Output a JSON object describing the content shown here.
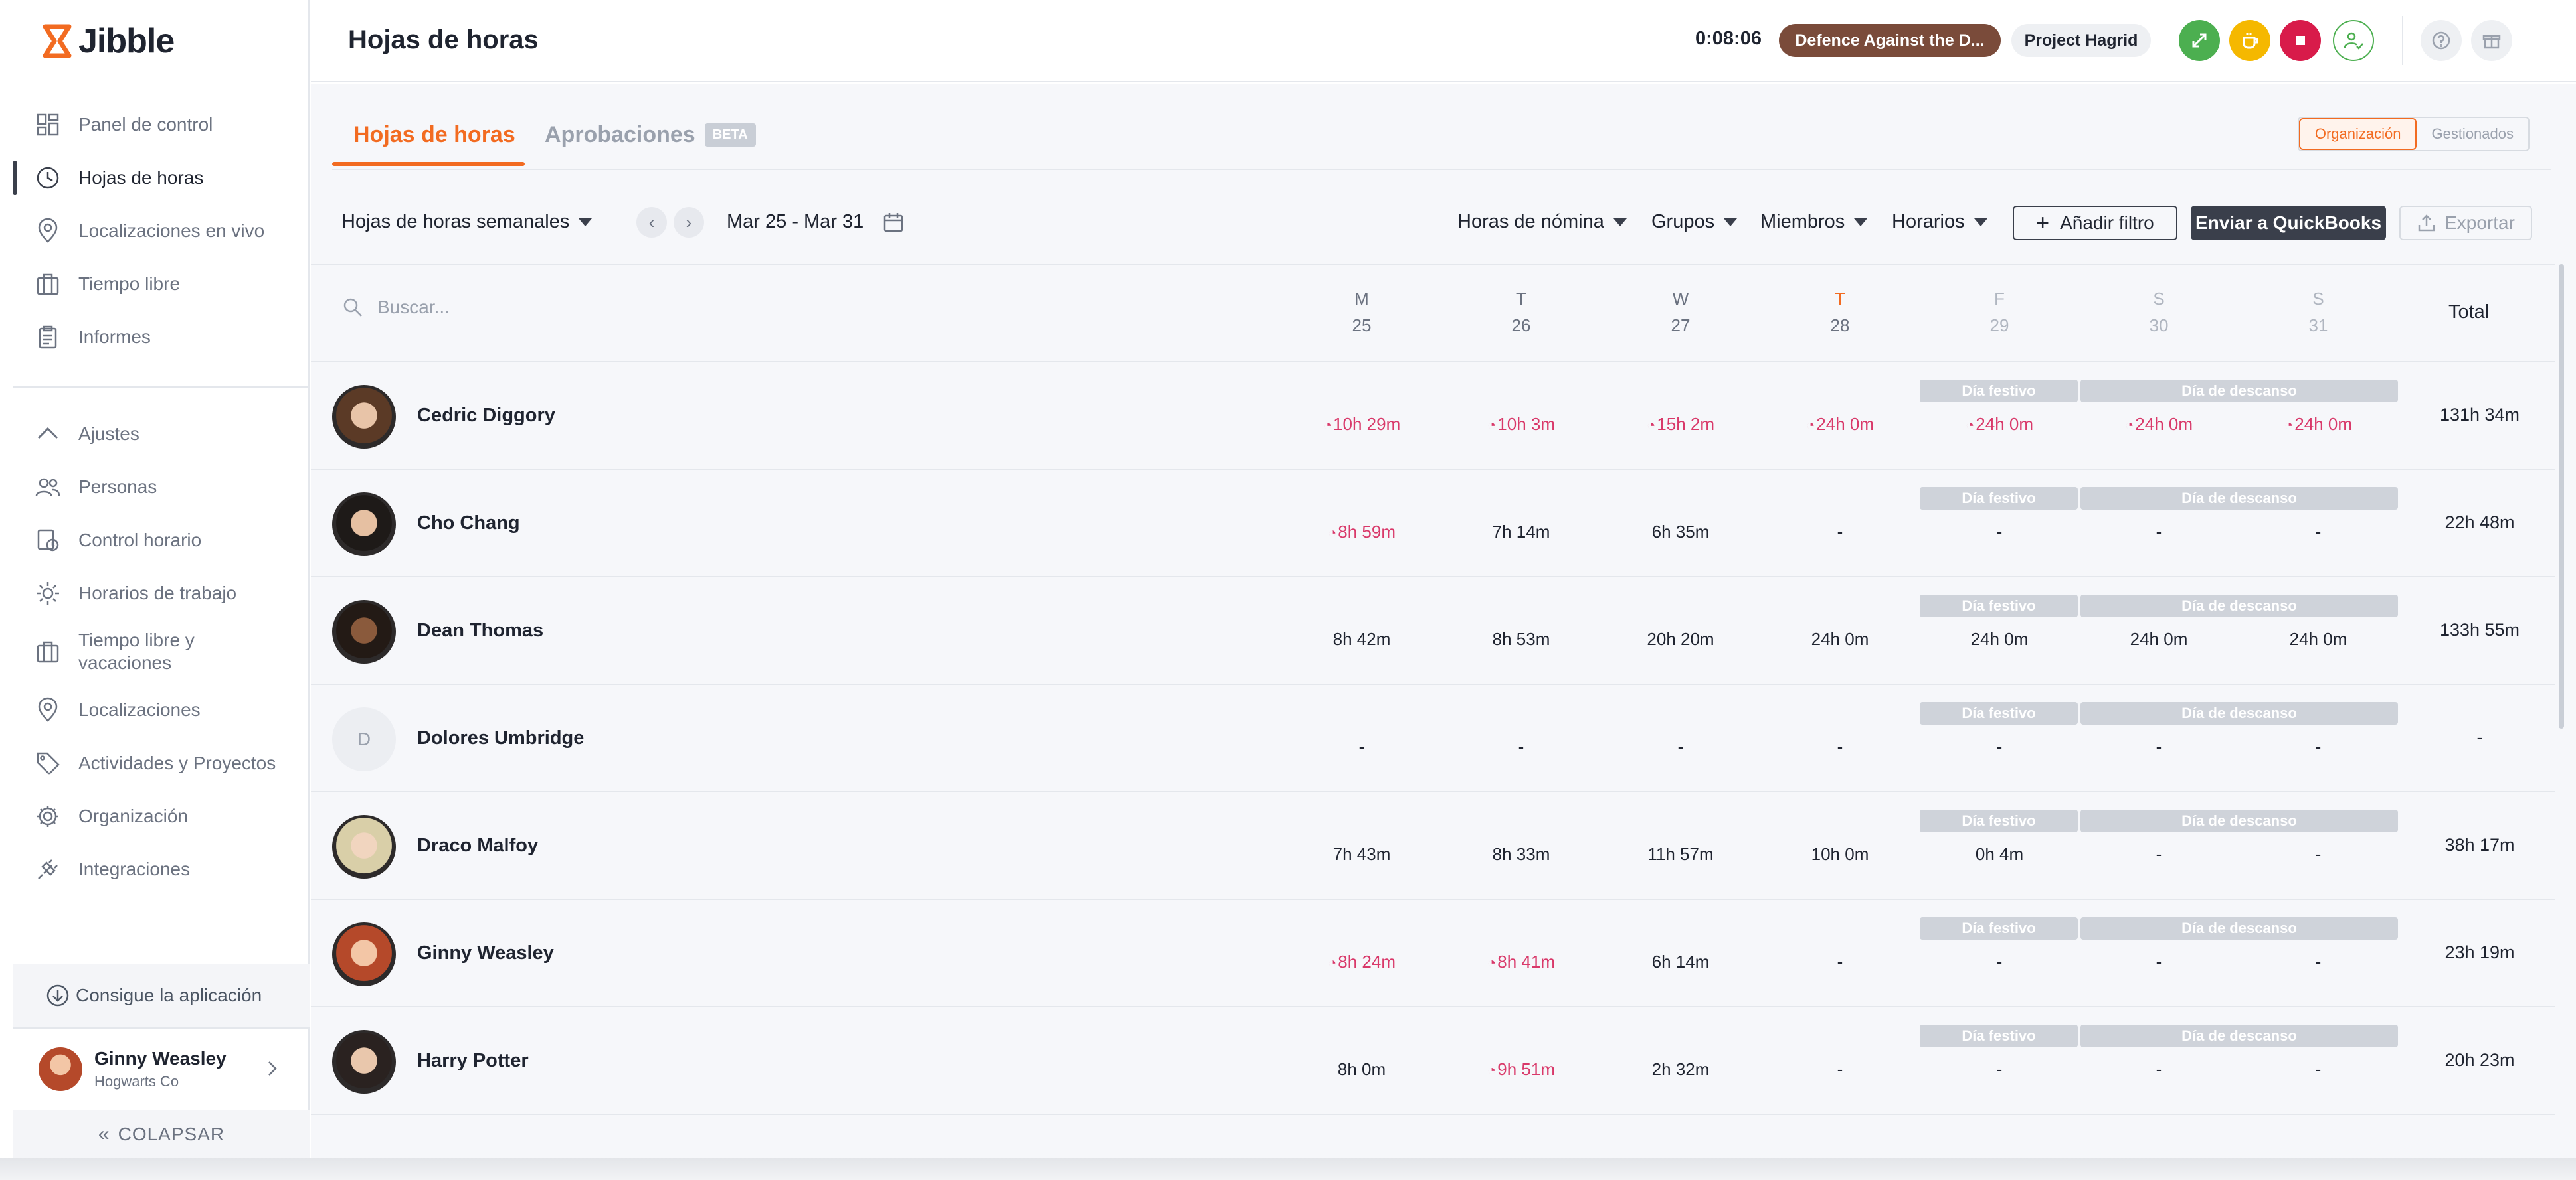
{
  "app": {
    "logo_text": "Jibble"
  },
  "sidebar": {
    "items": [
      {
        "label": "Panel de control",
        "icon": "dashboard-icon"
      },
      {
        "label": "Hojas de horas",
        "icon": "clock-icon"
      },
      {
        "label": "Localizaciones en vivo",
        "icon": "location-icon"
      },
      {
        "label": "Tiempo libre",
        "icon": "briefcase-icon"
      },
      {
        "label": "Informes",
        "icon": "clipboard-icon"
      }
    ],
    "settings_items": [
      {
        "label": "Ajustes",
        "icon": "chevron-up-icon"
      },
      {
        "label": "Personas",
        "icon": "people-icon"
      },
      {
        "label": "Control horario",
        "icon": "time-tracking-icon"
      },
      {
        "label": "Horarios de trabajo",
        "icon": "sun-icon"
      },
      {
        "label": "Tiempo libre y vacaciones",
        "icon": "briefcase-icon"
      },
      {
        "label": "Localizaciones",
        "icon": "location-icon"
      },
      {
        "label": "Actividades y Proyectos",
        "icon": "tag-icon"
      },
      {
        "label": "Organización",
        "icon": "gear-icon"
      },
      {
        "label": "Integraciones",
        "icon": "plug-icon"
      }
    ],
    "get_app": "Consigue la aplicación",
    "user": {
      "name": "Ginny Weasley",
      "org": "Hogwarts Co"
    },
    "collapse": "COLAPSAR"
  },
  "topbar": {
    "title": "Hojas de horas",
    "timer": "0:08:06",
    "activity": "Defence Against the D...",
    "project": "Project Hagrid"
  },
  "tabs": {
    "timesheets": "Hojas de horas",
    "approvals": "Aprobaciones",
    "beta": "BETA",
    "toggle_org": "Organización",
    "toggle_managed": "Gestionados"
  },
  "filters": {
    "period": "Hojas de horas semanales",
    "range": "Mar 25 - Mar 31",
    "payroll": "Horas de nómina",
    "groups": "Grupos",
    "members": "Miembros",
    "schedules": "Horarios",
    "add_filter": "Añadir filtro",
    "quickbooks": "Enviar a QuickBooks",
    "export": "Exportar"
  },
  "table": {
    "search_placeholder": "Buscar...",
    "total_label": "Total",
    "holiday_label": "Día festivo",
    "rest_label": "Día de descanso",
    "days": [
      {
        "letter": "M",
        "num": "25"
      },
      {
        "letter": "T",
        "num": "26"
      },
      {
        "letter": "W",
        "num": "27"
      },
      {
        "letter": "T",
        "num": "28"
      },
      {
        "letter": "F",
        "num": "29"
      },
      {
        "letter": "S",
        "num": "30"
      },
      {
        "letter": "S",
        "num": "31"
      }
    ],
    "rows": [
      {
        "name": "Cedric Diggory",
        "cells": [
          "10h 29m",
          "10h 3m",
          "15h 2m",
          "24h 0m",
          "24h 0m",
          "24h 0m",
          "24h 0m"
        ],
        "late": [
          true,
          true,
          true,
          true,
          true,
          true,
          true
        ],
        "total": "131h 34m"
      },
      {
        "name": "Cho Chang",
        "cells": [
          "8h 59m",
          "7h 14m",
          "6h 35m",
          "-",
          "-",
          "-",
          "-"
        ],
        "late": [
          true,
          false,
          false,
          false,
          false,
          false,
          false
        ],
        "total": "22h 48m"
      },
      {
        "name": "Dean Thomas",
        "cells": [
          "8h 42m",
          "8h 53m",
          "20h 20m",
          "24h 0m",
          "24h 0m",
          "24h 0m",
          "24h 0m"
        ],
        "late": [
          false,
          false,
          false,
          false,
          false,
          false,
          false
        ],
        "total": "133h 55m"
      },
      {
        "name": "Dolores Umbridge",
        "initial": "D",
        "cells": [
          "-",
          "-",
          "-",
          "-",
          "-",
          "-",
          "-"
        ],
        "late": [
          false,
          false,
          false,
          false,
          false,
          false,
          false
        ],
        "total": "-"
      },
      {
        "name": "Draco Malfoy",
        "cells": [
          "7h 43m",
          "8h 33m",
          "11h 57m",
          "10h 0m",
          "0h 4m",
          "-",
          "-"
        ],
        "late": [
          false,
          false,
          false,
          false,
          false,
          false,
          false
        ],
        "total": "38h 17m"
      },
      {
        "name": "Ginny Weasley",
        "cells": [
          "8h 24m",
          "8h 41m",
          "6h 14m",
          "-",
          "-",
          "-",
          "-"
        ],
        "late": [
          true,
          true,
          false,
          false,
          false,
          false,
          false
        ],
        "total": "23h 19m"
      },
      {
        "name": "Harry Potter",
        "cells": [
          "8h 0m",
          "9h 51m",
          "2h 32m",
          "-",
          "-",
          "-",
          "-"
        ],
        "late": [
          false,
          true,
          false,
          false,
          false,
          false,
          false
        ],
        "total": "20h 23m"
      }
    ]
  },
  "colors": {
    "accent": "#f26b21",
    "late": "#d9396a",
    "activity_pill": "#7a4b3a",
    "dark_button": "#3a3f4b"
  }
}
